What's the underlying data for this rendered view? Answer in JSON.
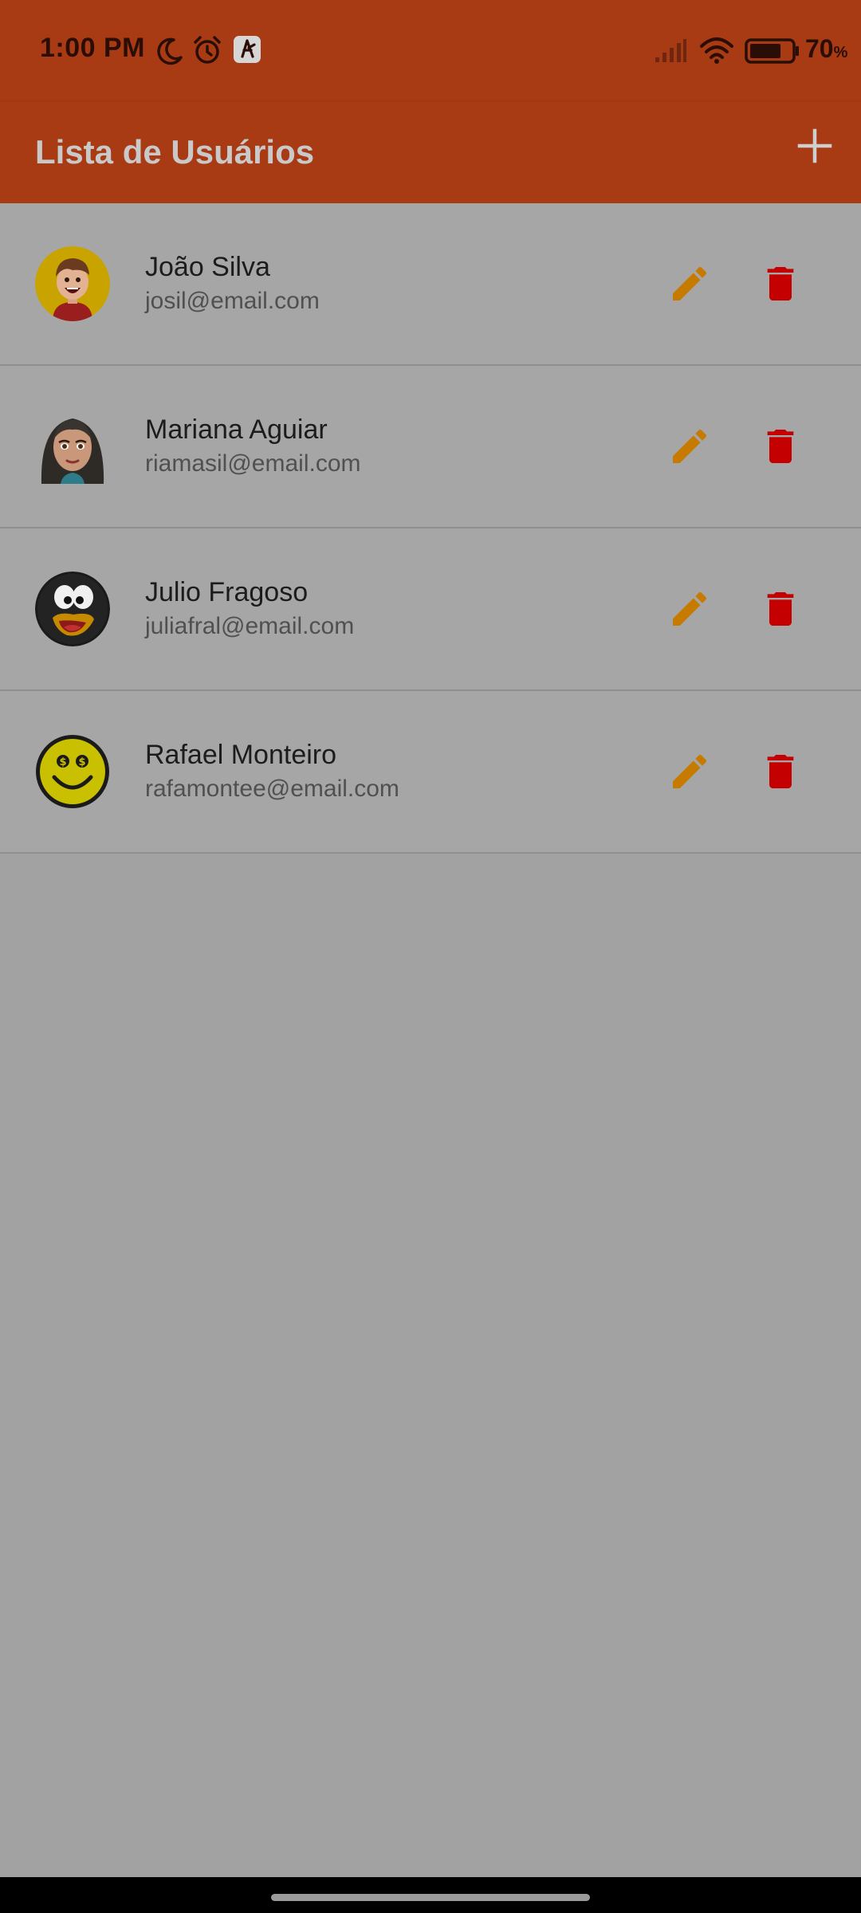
{
  "status_bar": {
    "time": "1:00 PM",
    "battery_percent": "70",
    "battery_percent_sign": "%",
    "icons": [
      "moon-icon",
      "alarm-icon",
      "app-notification-icon",
      "signal-icon",
      "wifi-icon",
      "battery-icon"
    ]
  },
  "app_bar": {
    "title": "Lista de Usuários",
    "add_icon": "plus-icon",
    "color": "#a83a14"
  },
  "users": [
    {
      "name": "João Silva",
      "email": "josil@email.com",
      "avatar": "cartoon-boy-avatar"
    },
    {
      "name": "Mariana Aguiar",
      "email": "riamasil@email.com",
      "avatar": "cartoon-woman-avatar"
    },
    {
      "name": "Julio Fragoso",
      "email": "juliafral@email.com",
      "avatar": "cartoon-penguin-avatar"
    },
    {
      "name": "Rafael Monteiro",
      "email": "rafamontee@email.com",
      "avatar": "dollar-smiley-avatar"
    }
  ],
  "actions": {
    "edit_icon": "pencil-icon",
    "edit_color": "#c77a00",
    "delete_icon": "trash-icon",
    "delete_color": "#c40000"
  }
}
